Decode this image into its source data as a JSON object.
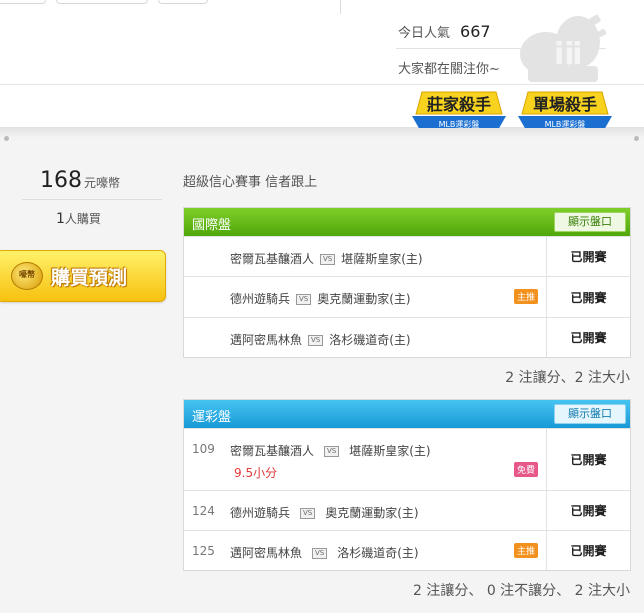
{
  "header": {
    "today_label": "今日人氣",
    "today_count": "667",
    "tagline": "大家都在關注你~",
    "badges": [
      {
        "title": "莊家殺手",
        "sub": "MLB運彩盤"
      },
      {
        "title": "單場殺手",
        "sub": "MLB運彩盤"
      }
    ]
  },
  "sidebar": {
    "price": "168",
    "price_unit": "元嚎幣",
    "buyers": "1",
    "buyers_unit": "人購買",
    "coin_text": "嚎幣",
    "buy_label": "購買預測"
  },
  "main": {
    "subtitle": "超級信心賽事 信者跟上",
    "international": {
      "title": "國際盤",
      "show_label": "顯示盤口",
      "rows": [
        {
          "away": "密爾瓦基釀酒人",
          "vs": "VS",
          "home": "堪薩斯皇家(主)",
          "tag": "",
          "status": "已開賽"
        },
        {
          "away": "德州遊騎兵",
          "vs": "VS",
          "home": "奧克蘭運動家(主)",
          "tag": "主推",
          "status": "已開賽"
        },
        {
          "away": "邁阿密馬林魚",
          "vs": "VS",
          "home": "洛杉磯道奇(主)",
          "tag": "",
          "status": "已開賽"
        }
      ],
      "summary": "2 注讓分、2 注大小"
    },
    "sports_lottery": {
      "title": "運彩盤",
      "show_label": "顯示盤口",
      "rows": [
        {
          "num": "109",
          "away": "密爾瓦基釀酒人",
          "vs": "VS",
          "home": "堪薩斯皇家(主)",
          "spread": "9.5小分",
          "tag": "免費",
          "status": "已開賽"
        },
        {
          "num": "124",
          "away": "德州遊騎兵",
          "vs": "VS",
          "home": "奧克蘭運動家(主)",
          "tag": "",
          "status": "已開賽"
        },
        {
          "num": "125",
          "away": "邁阿密馬林魚",
          "vs": "VS",
          "home": "洛杉磯道奇(主)",
          "tag": "主推",
          "status": "已開賽"
        }
      ],
      "summary": "2 注讓分、 0 注不讓分、 2 注大小"
    }
  }
}
